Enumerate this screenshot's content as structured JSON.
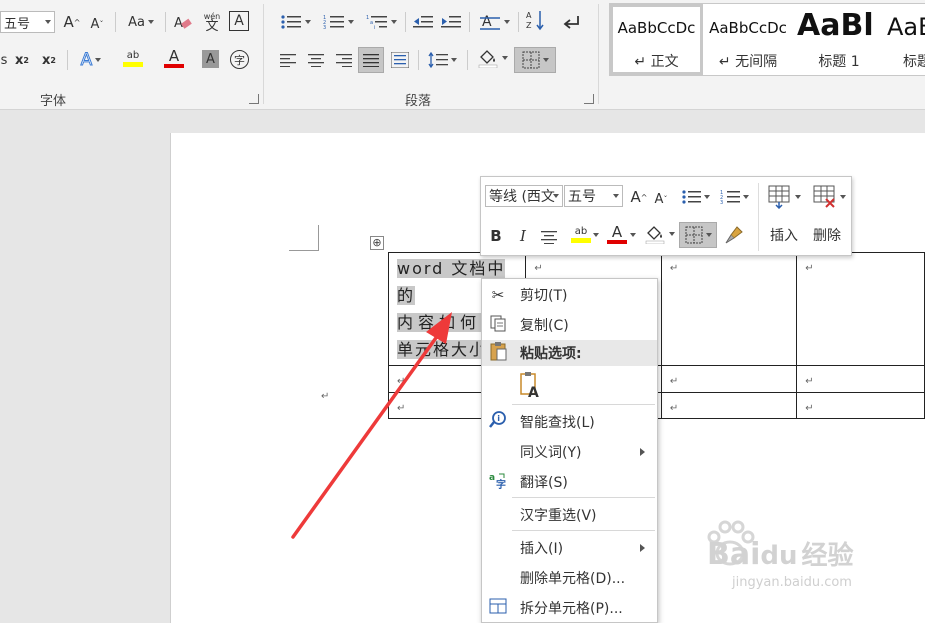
{
  "ribbon": {
    "font_group": {
      "label": "字体",
      "font_size": "五号",
      "grow_font": "A",
      "shrink_font": "A",
      "change_case": "Aa",
      "phonetic_top": "wén",
      "phonetic_bottom": "文",
      "char_border": "A",
      "subscript": "x",
      "superscript": "x",
      "text_effect": "A",
      "highlight": "ab",
      "font_color": "A",
      "char_shading": "A",
      "enclose": "字",
      "partial_left": "s"
    },
    "paragraph_group": {
      "label": "段落"
    },
    "styles": [
      {
        "sample": "AaBbCcDc",
        "name": "正文"
      },
      {
        "sample": "AaBbCcDc",
        "name": "无间隔"
      },
      {
        "sample": "AaBl",
        "name": "标题 1"
      },
      {
        "sample": "AaB",
        "name": "标题"
      }
    ],
    "colors": {
      "highlight": "#ffff00",
      "font_color": "#e00000"
    }
  },
  "document": {
    "cell_text": [
      "word  文档中的",
      "内容如何",
      "单元格大小"
    ],
    "paragraph_mark": "↵",
    "move_handle": "⊕"
  },
  "mini_toolbar": {
    "font_name": "等线 (西文",
    "font_size": "五号",
    "grow": "A",
    "shrink": "A",
    "bold": "B",
    "italic": "I",
    "highlight": "ab",
    "font_color": "A",
    "insert_label": "插入",
    "delete_label": "删除"
  },
  "context_menu": {
    "items": [
      {
        "label": "剪切(T)"
      },
      {
        "label": "复制(C)"
      },
      {
        "label": "粘贴选项:"
      },
      {
        "label": "智能查找(L)"
      },
      {
        "label": "同义词(Y)"
      },
      {
        "label": "翻译(S)"
      },
      {
        "label": "汉字重选(V)"
      },
      {
        "label": "插入(I)"
      },
      {
        "label": "删除单元格(D)..."
      },
      {
        "label": "拆分单元格(P)..."
      }
    ]
  },
  "watermark": {
    "brand": "Bai",
    "brand2": "du",
    "suffix": "经验",
    "url": "jingyan.baidu.com"
  }
}
